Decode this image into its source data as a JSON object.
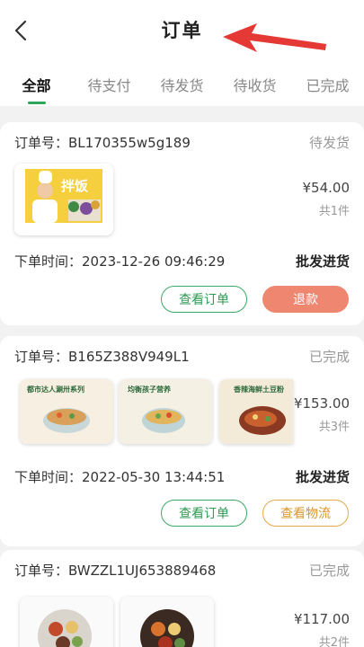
{
  "header": {
    "title": "订单"
  },
  "tabs": [
    {
      "label": "全部"
    },
    {
      "label": "待支付"
    },
    {
      "label": "待发货"
    },
    {
      "label": "待收货"
    },
    {
      "label": "已完成"
    }
  ],
  "colors": {
    "accent": "#2fa45a",
    "refund": "#ee8670",
    "logistics": "#e6a94a",
    "arrow": "#e53935"
  },
  "orders": [
    {
      "order_no": "订单号：BL170355w5g189",
      "status": "待发货",
      "thumb_text": [
        "拌饭"
      ],
      "price": "¥54.00",
      "count": "共1件",
      "time": "下单时间：2023-12-26 09:46:29",
      "type": "批发进货",
      "buttons": [
        "查看订单",
        "退款"
      ]
    },
    {
      "order_no": "订单号：B165Z388V949L1",
      "status": "已完成",
      "thumb_text": [
        "都市达人涮卅系列",
        "均衡孩子营养",
        "香辣海鲜土豆粉"
      ],
      "price": "¥153.00",
      "count": "共3件",
      "time": "下单时间：2022-05-30 13:44:51",
      "type": "批发进货",
      "buttons": [
        "查看订单",
        "查看物流"
      ]
    },
    {
      "order_no": "订单号：BWZZL1UJ653889468",
      "status": "已完成",
      "price": "¥117.00",
      "count": "共2件"
    }
  ]
}
